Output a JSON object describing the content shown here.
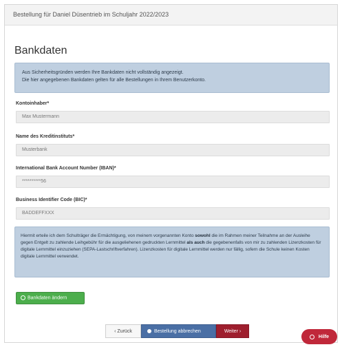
{
  "window": {
    "title": "Bestellung für Daniel Düsentrieb im Schuljahr 2022/2023"
  },
  "page": {
    "heading": "Bankdaten"
  },
  "info_box": {
    "line1": "Aus Sicherheitsgründen werden Ihre Bankdaten nicht vollständig angezeigt.",
    "line2": "Die hier angegebenen Bankdaten gelten für alle Bestellungen in Ihrem Benutzerkonto."
  },
  "fields": {
    "account_holder": {
      "label": "Kontoinhaber*",
      "value": "Max Mustermann"
    },
    "bank_name": {
      "label": "Name des Kreditinstituts*",
      "value": "Musterbank"
    },
    "iban": {
      "label": "International Bank Account Number (IBAN)*",
      "value": "**********56"
    },
    "bic": {
      "label": "Business Identifier Code (BIC)*",
      "value": "BADDEFFXXX"
    }
  },
  "notice": {
    "part1": "Hiermit erteile ich dem Schulträger die Ermächtigung, von meinem vorgenannten Konto ",
    "bold1": "sowohl",
    "part2": " die im Rahmen meiner Teilnahme an der Ausleihe gegen Entgelt zu zahlende Leihgebühr für die ausgeliehenen gedruckten Lernmittel ",
    "bold2": "als auch",
    "part3": " die gegebenenfalls von mir zu zahlenden Lizenzkosten für digitale Lernmittel einzuziehen (SEPA-Lastschriftverfahren). Lizenzkosten für digitale Lernmittel werden nur fällig, sofern die Schule keinen Kosten digitale Lernmittel verwendet."
  },
  "buttons": {
    "change_bank": "Bankdaten ändern",
    "back": "‹ Zurück",
    "finish": "Bestellung abbrechen",
    "next": "Weiter ›",
    "help": "Hilfe"
  }
}
